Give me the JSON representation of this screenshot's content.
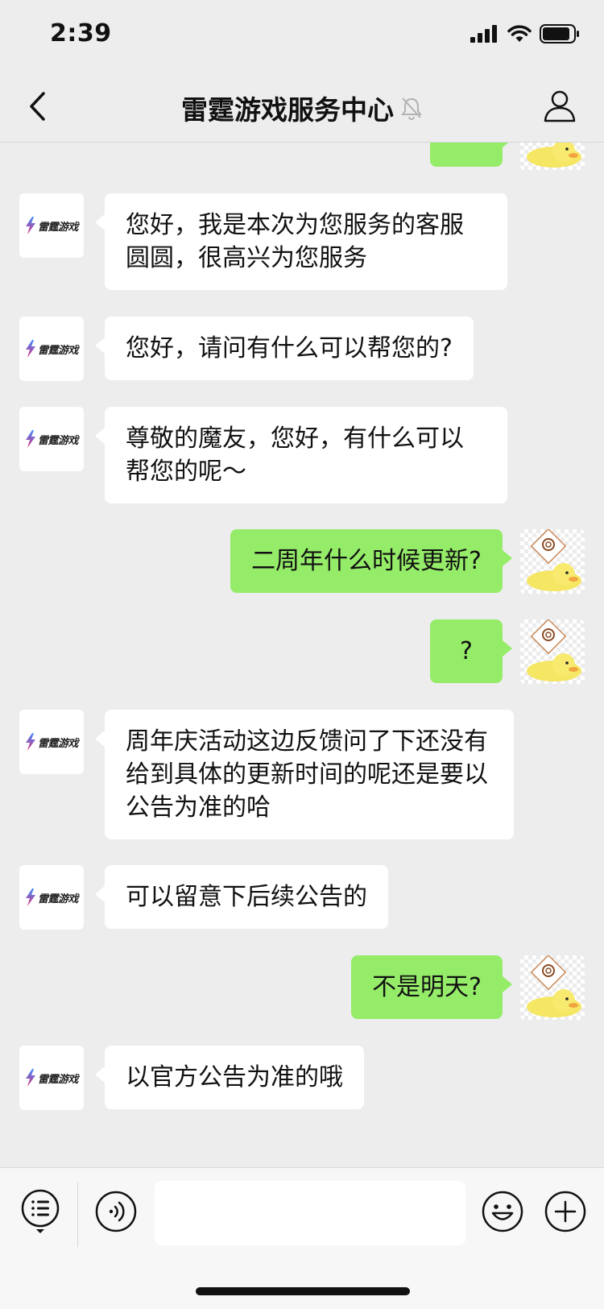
{
  "status_bar": {
    "time": "2:39"
  },
  "nav": {
    "title": "雷霆游戏服务中心"
  },
  "logo_text": "雷霆游戏",
  "messages": [
    {
      "side": "left",
      "text": "您好，我是本次为您服务的客服圆圆，很高兴为您服务"
    },
    {
      "side": "left",
      "text": "您好，请问有什么可以帮您的?"
    },
    {
      "side": "left",
      "text": "尊敬的魔友，您好，有什么可以帮您的呢～"
    },
    {
      "side": "right",
      "text": "二周年什么时候更新?"
    },
    {
      "side": "right",
      "text": "?"
    },
    {
      "side": "left",
      "text": "周年庆活动这边反馈问了下还没有给到具体的更新时间的呢还是要以公告为准的哈"
    },
    {
      "side": "left",
      "text": "可以留意下后续公告的"
    },
    {
      "side": "right",
      "text": "不是明天?"
    },
    {
      "side": "left",
      "text": "以官方公告为准的哦"
    }
  ],
  "input": {
    "value": ""
  },
  "colors": {
    "background": "#ededed",
    "bubble_self": "#95ec69",
    "bubble_other": "#ffffff",
    "brand_gradient_a": "#3b8cff",
    "brand_gradient_b": "#e0307b"
  }
}
